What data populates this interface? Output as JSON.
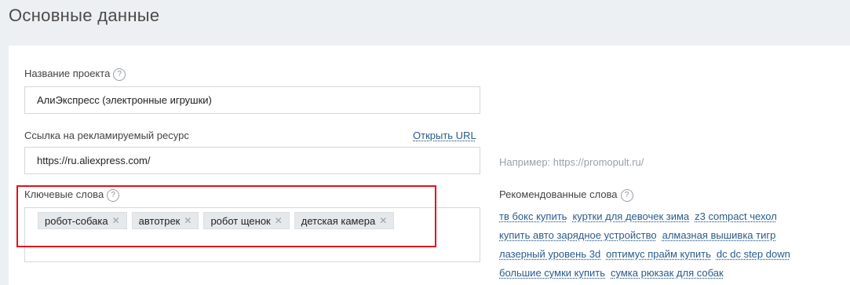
{
  "section": {
    "title": "Основные данные"
  },
  "project": {
    "label": "Название проекта",
    "value": "АлиЭкспресс (электронные игрушки)"
  },
  "resource": {
    "label": "Ссылка на рекламируемый ресурс",
    "open_url": "Открыть URL",
    "value": "https://ru.aliexpress.com/",
    "hint": "Например: https://promopult.ru/"
  },
  "keywords": {
    "label": "Ключевые слова",
    "tags": [
      "робот-собака",
      "автотрек",
      "робот щенок",
      "детская камера"
    ]
  },
  "recommended": {
    "label": "Рекомендованные слова",
    "lines": [
      [
        "тв бокс купить",
        "куртки для девочек зима",
        "z3 compact чехол"
      ],
      [
        "купить авто зарядное устройство",
        "алмазная вышивка тигр"
      ],
      [
        "лазерный уровень 3d",
        "оптимус прайм купить",
        "dc dc step down"
      ],
      [
        "большие сумки купить",
        "сумка рюкзак для собак"
      ]
    ]
  },
  "icons": {
    "help": "question-circle-icon",
    "remove": "close-icon"
  },
  "colors": {
    "highlight": "#e3101b",
    "link": "#2a5b8c"
  }
}
